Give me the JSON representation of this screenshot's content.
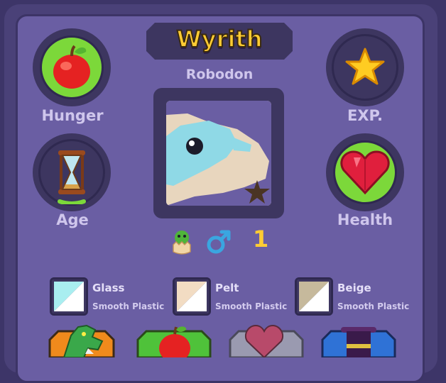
{
  "pet": {
    "name": "Wyrith",
    "species": "Robodon",
    "rarity": "1",
    "gender_icon": "male-symbol-icon",
    "hatch_icon": "hatchling-icon"
  },
  "stats": {
    "hunger": {
      "label": "Hunger",
      "icon": "apple-icon",
      "level": 1.0
    },
    "exp": {
      "label": "EXP.",
      "icon": "star-icon",
      "level": 0.0
    },
    "age": {
      "label": "Age",
      "icon": "hourglass-icon",
      "level": 0.08
    },
    "health": {
      "label": "Health",
      "icon": "heart-icon",
      "level": 1.0
    }
  },
  "colors": [
    {
      "name": "Glass",
      "material": "Smooth Plastic",
      "swatch": [
        "#a9eef0",
        "#ffffff"
      ]
    },
    {
      "name": "Pelt",
      "material": "Smooth Plastic",
      "swatch": [
        "#f2dcc3",
        "#ffffff"
      ]
    },
    {
      "name": "Beige",
      "material": "Smooth Plastic",
      "swatch": [
        "#c6b99c",
        "#ffffff"
      ]
    }
  ],
  "accent": {
    "title": "#ffcc33",
    "fill": "#7cd83a",
    "panel": "#6a5ea3"
  },
  "toolbar": [
    {
      "icon": "dragon-icon",
      "bg": "#f08a1c"
    },
    {
      "icon": "apple-icon",
      "bg": "#4fc23a"
    },
    {
      "icon": "heart-icon",
      "bg": "#9a9ab0"
    },
    {
      "icon": "top-hat-icon",
      "bg": "#2f72d6"
    }
  ]
}
